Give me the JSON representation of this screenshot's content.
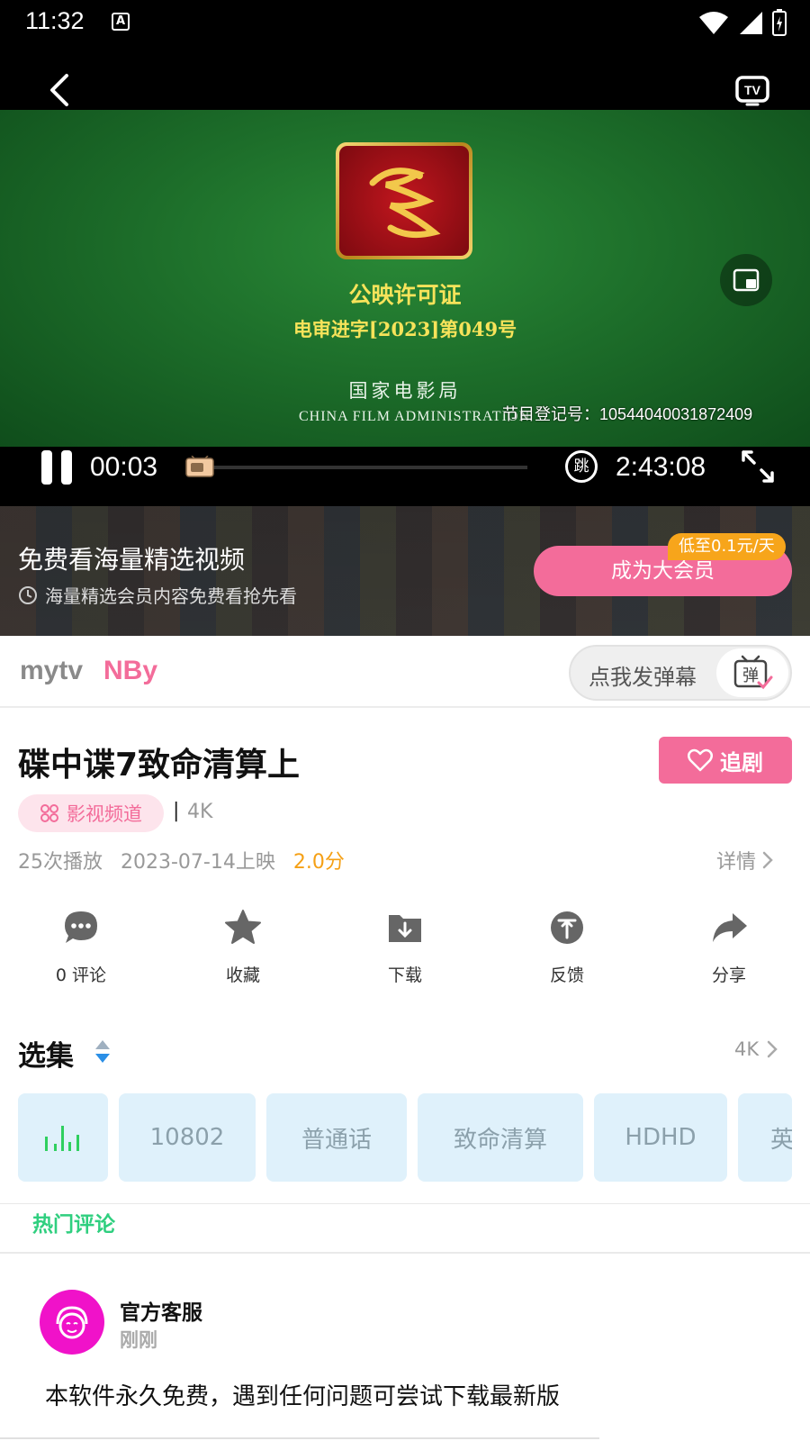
{
  "status_bar": {
    "time": "11:32",
    "a_icon": "A"
  },
  "player": {
    "license_title": "公映许可证",
    "license_number": "电审进字[2023]第049号",
    "bureau_cn": "国家电影局",
    "bureau_en": "CHINA FILM ADMINISTRATION",
    "registration": "节目登记号：10544040031872409",
    "current_time": "00:03",
    "total_time": "2:43:08",
    "skip_label": "跳",
    "progress_fraction": 0.0003
  },
  "vip_banner": {
    "headline": "免费看海量精选视频",
    "subline": "海量精选会员内容免费看抢先看",
    "button_label": "成为大会员",
    "price_badge": "低至0.1元/天"
  },
  "channel_bar": {
    "tab_mytv": "mytv",
    "tab_nby": "NBy",
    "danmu_placeholder": "点我发弹幕",
    "danmu_icon_char": "弹"
  },
  "video_info": {
    "title": "碟中谍7致命清算上",
    "follow_label": "追剧",
    "channel_tag": "影视频道",
    "separator": "|",
    "quality": "4K",
    "plays": "25次播放",
    "release": "2023-07-14上映",
    "score": "2.0分",
    "details_label": "详情"
  },
  "actions": [
    {
      "label": "0 评论",
      "icon": "comment-icon"
    },
    {
      "label": "收藏",
      "icon": "star-icon"
    },
    {
      "label": "下载",
      "icon": "download-icon"
    },
    {
      "label": "反馈",
      "icon": "feedback-icon"
    },
    {
      "label": "分享",
      "icon": "share-icon"
    }
  ],
  "episodes": {
    "title": "选集",
    "quality": "4K",
    "chips": [
      "",
      "10802",
      "普通话",
      "致命清算",
      "HDHD",
      "英"
    ]
  },
  "comments": {
    "section_title": "热门评论",
    "items": [
      {
        "author": "官方客服",
        "time": "刚刚",
        "text": "本软件永久免费，遇到任何问题可尝试下载最新版"
      }
    ]
  },
  "colors": {
    "accent_pink": "#f36c9a",
    "score_orange": "#f5a015",
    "hot_green": "#2fcf7f",
    "avatar_magenta": "#f012c9"
  }
}
